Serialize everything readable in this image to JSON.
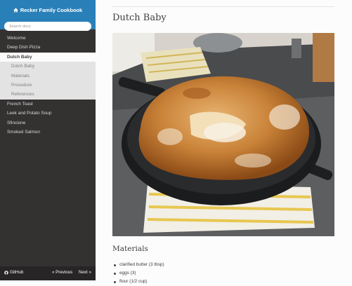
{
  "sidebar": {
    "brand": "Recker Family Cookbook",
    "search_placeholder": "Search docs",
    "items": [
      {
        "label": "Welcome"
      },
      {
        "label": "Deep Dish Pizza"
      },
      {
        "label": "Dutch Baby",
        "current": true
      },
      {
        "label": "French Toast"
      },
      {
        "label": "Leek and Potato Soup"
      },
      {
        "label": "Sfincione"
      },
      {
        "label": "Smoked Salmon"
      }
    ],
    "subitems": [
      {
        "label": "Dutch Baby"
      },
      {
        "label": "Materials"
      },
      {
        "label": "Procedure"
      },
      {
        "label": "References"
      }
    ],
    "footer": {
      "github": "GitHub",
      "previous": "« Previous",
      "next": "Next »"
    }
  },
  "page": {
    "title": "Dutch Baby",
    "section": "Materials",
    "materials": [
      "clarified butter (3 tbsp)",
      "eggs (3)",
      "flour (1/2 cup)"
    ]
  },
  "colors": {
    "accent": "#2980b9",
    "sidebar_bg": "#343131",
    "sidebar_footer": "#272525"
  }
}
